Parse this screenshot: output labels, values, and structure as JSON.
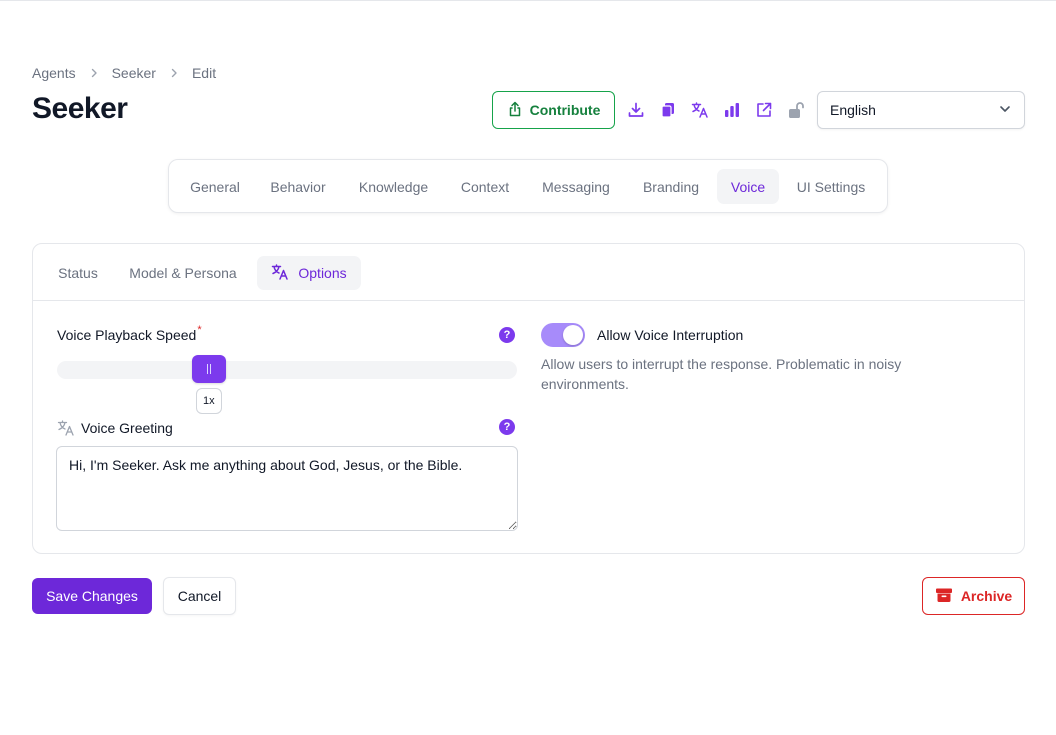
{
  "breadcrumb": {
    "items": [
      "Agents",
      "Seeker",
      "Edit"
    ]
  },
  "header": {
    "title": "Seeker",
    "contribute_label": "Contribute",
    "language": "English",
    "action_icons": [
      "download-icon",
      "copy-icon",
      "translate-icon",
      "bar-chart-icon",
      "external-link-icon",
      "unlock-icon"
    ]
  },
  "main_tabs": {
    "items": [
      "General",
      "Behavior",
      "Knowledge",
      "Context",
      "Messaging",
      "Branding",
      "Voice",
      "UI Settings"
    ],
    "active": "Voice"
  },
  "sub_tabs": {
    "items": [
      "Status",
      "Model & Persona",
      "Options"
    ],
    "active": "Options"
  },
  "voice_options": {
    "playback_speed_label": "Voice Playback Speed",
    "required_marker": "*",
    "speed_value_label": "1x",
    "speed_fraction": 0.33,
    "greeting_label": "Voice Greeting",
    "greeting_text": "Hi, I'm Seeker. Ask me anything about God, Jesus, or the Bible.",
    "help_glyph": "?",
    "interruption_label": "Allow Voice Interruption",
    "interruption_enabled": true,
    "interruption_description": "Allow users to interrupt the response. Problematic in noisy environments."
  },
  "footer": {
    "save_label": "Save Changes",
    "cancel_label": "Cancel",
    "archive_label": "Archive"
  },
  "colors": {
    "accent": "#6d28d9",
    "accent_light": "#a78bfa",
    "success": "#15803d",
    "danger": "#dc2626"
  }
}
